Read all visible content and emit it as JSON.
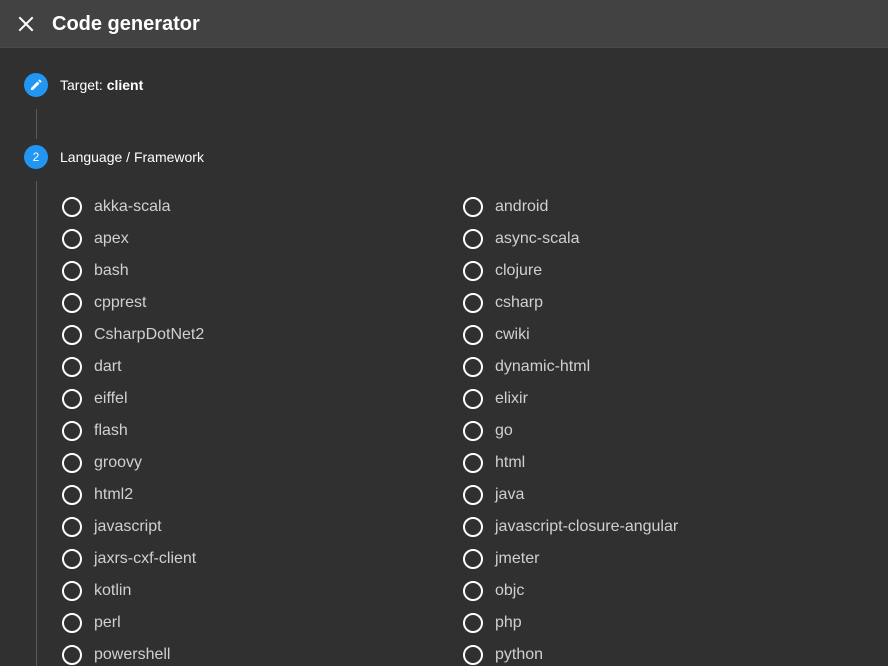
{
  "header": {
    "title": "Code generator",
    "close_icon": "close-icon"
  },
  "steps": [
    {
      "number": "",
      "icon": "pencil-icon",
      "label_prefix": "Target: ",
      "label_value": "client"
    },
    {
      "number": "2",
      "label": "Language / Framework"
    }
  ],
  "languages": {
    "left": [
      "akka-scala",
      "apex",
      "bash",
      "cpprest",
      "CsharpDotNet2",
      "dart",
      "eiffel",
      "flash",
      "groovy",
      "html2",
      "javascript",
      "jaxrs-cxf-client",
      "kotlin",
      "perl",
      "powershell"
    ],
    "right": [
      "android",
      "async-scala",
      "clojure",
      "csharp",
      "cwiki",
      "dynamic-html",
      "elixir",
      "go",
      "html",
      "java",
      "javascript-closure-angular",
      "jmeter",
      "objc",
      "php",
      "python"
    ]
  },
  "colors": {
    "accent": "#2196f3",
    "background": "#303030",
    "header": "#424242"
  }
}
